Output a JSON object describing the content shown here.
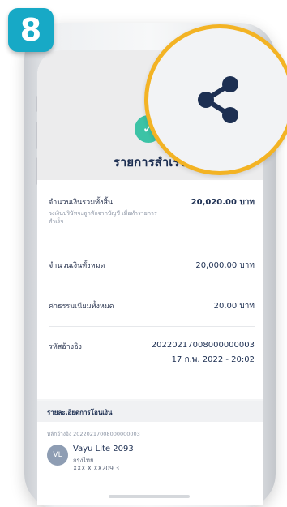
{
  "step_badge": "8",
  "screen": {
    "title": "รายการสำเร็จ",
    "status_icon": "check-icon",
    "share_icon": "share-icon",
    "rows": [
      {
        "label": "จำนวนเงินรวมทั้งสิ้น",
        "value": "20,020.00 บาท",
        "sub": "วงเงินบริษัทจะถูกหักจากบัญชี เมื่อทำรายการสำเร็จ"
      },
      {
        "label": "จำนวนเงินทั้งหมด",
        "value": "20,000.00 บาท"
      },
      {
        "label": "ค่าธรรมเนียมทั้งหมด",
        "value": "20.00 บาท"
      },
      {
        "label": "รหัสอ้างอิง",
        "value": "20220217008000000003",
        "value2": "17 ก.พ. 2022 - 20:02"
      }
    ],
    "detail_header": "รายละเอียดการโอนเงิน",
    "detail_ref": "หลักอ้างอิง 20220217008000000003",
    "recipient": {
      "initials": "VL",
      "name": "Vayu Lite 2093",
      "bank": "กรุงไทย",
      "account": "XXX X XX209 3"
    }
  },
  "colors": {
    "badge": "#17a9c6",
    "highlight_ring": "#f3b324",
    "success": "#3cc3a6",
    "navy": "#1d2f52"
  }
}
